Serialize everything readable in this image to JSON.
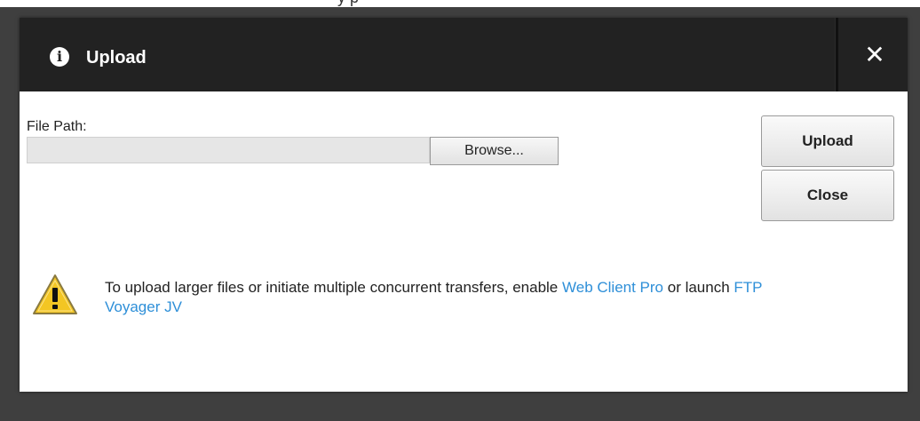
{
  "background_text": "y                                    p",
  "dialog": {
    "title": "Upload",
    "title_icon": "info-icon",
    "close_symbol": "✕"
  },
  "form": {
    "file_path_label": "File Path:",
    "file_path_value": "",
    "browse_label": "Browse..."
  },
  "actions": {
    "upload_label": "Upload",
    "close_label": "Close"
  },
  "notice": {
    "icon": "warning-icon",
    "text_before": "To upload larger files or initiate multiple concurrent transfers, enable ",
    "link1": "Web Client Pro",
    "text_middle": " or launch ",
    "link2": "FTP Voyager JV"
  },
  "colors": {
    "titlebar": "#222222",
    "overlay": "#3f3f3f",
    "link": "#2e8fd8",
    "warning_fill": "#f3c623"
  }
}
